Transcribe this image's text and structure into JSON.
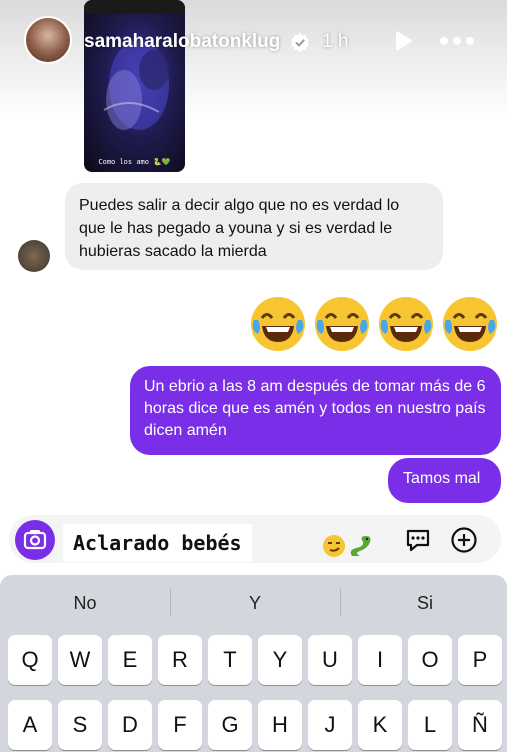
{
  "header": {
    "username": "samaharalobatonklug",
    "time": "1 h",
    "play_icon": "play-icon",
    "more_icon": "more-dots-icon",
    "verified_icon": "verified-badge-icon"
  },
  "story_thumbnail": {
    "caption": "Como los amo 🐍💚"
  },
  "messages": {
    "incoming_1": "Puedes salir a decir algo que no es verdad lo que le has pegado a youna y si es verdad le hubieras sacado la mierda",
    "emoji_reply": "😂😂😂😂",
    "outgoing_1": "Un ebrio a las 8 am después de tomar más de 6 horas dice que es amén y todos en nuestro país dicen amén",
    "outgoing_2": "Tamos mal"
  },
  "composer": {
    "caption_text": "Aclarado bebés",
    "caption_emoji": "😏🐍"
  },
  "keyboard": {
    "suggestions": [
      "No",
      "Y",
      "Si"
    ],
    "row1": [
      "Q",
      "W",
      "E",
      "R",
      "T",
      "Y",
      "U",
      "I",
      "O",
      "P"
    ],
    "row2": [
      "A",
      "S",
      "D",
      "F",
      "G",
      "H",
      "J",
      "K",
      "L",
      "Ñ"
    ]
  },
  "colors": {
    "accent_purple": "#7a2ee8",
    "incoming_bubble": "#eeeeef",
    "keyboard_bg": "#d4d6dd"
  }
}
